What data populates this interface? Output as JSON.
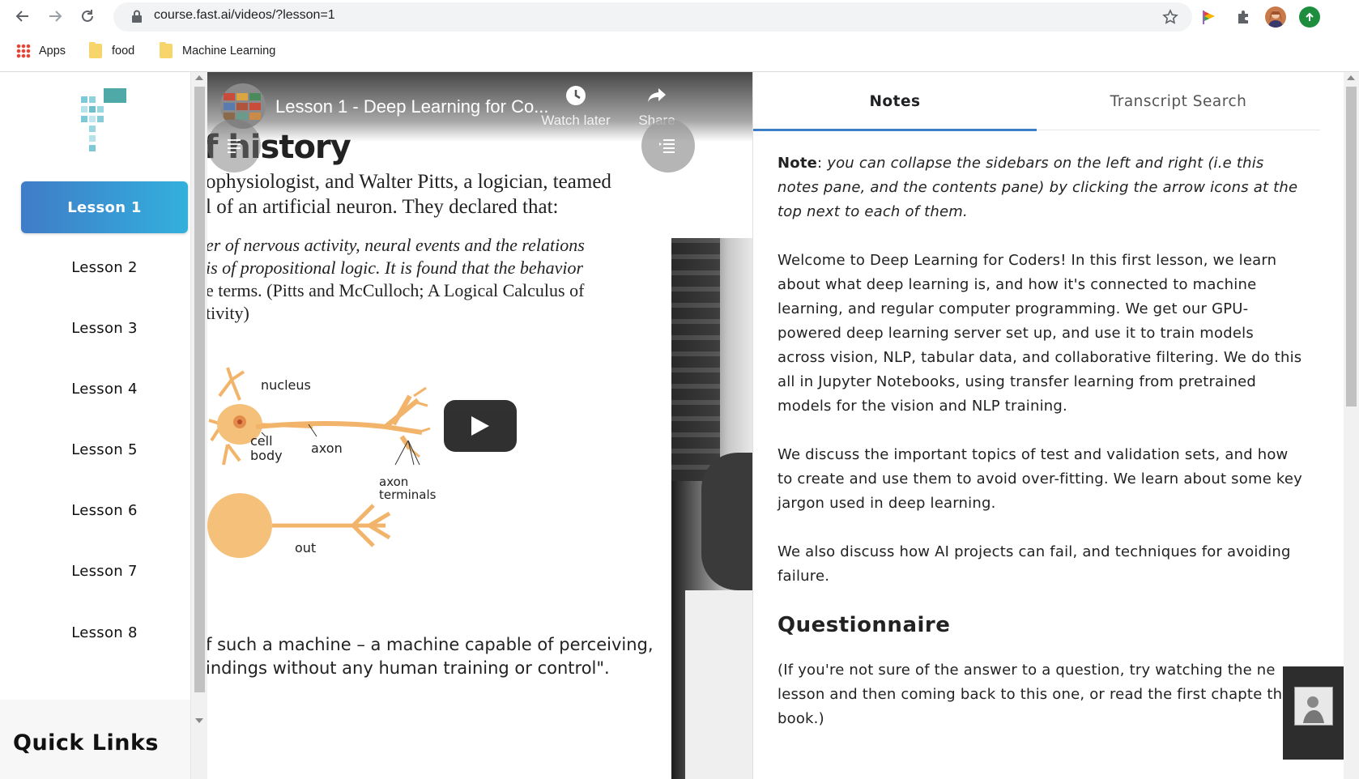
{
  "browser": {
    "url": "course.fast.ai/videos/?lesson=1",
    "bookmarks": [
      {
        "label": "Apps"
      },
      {
        "label": "food"
      },
      {
        "label": "Machine Learning"
      }
    ]
  },
  "sidebar": {
    "lessons": [
      {
        "label": "Lesson 1",
        "active": true
      },
      {
        "label": "Lesson 2"
      },
      {
        "label": "Lesson 3"
      },
      {
        "label": "Lesson 4"
      },
      {
        "label": "Lesson 5"
      },
      {
        "label": "Lesson 6"
      },
      {
        "label": "Lesson 7"
      },
      {
        "label": "Lesson 8"
      }
    ],
    "quick_links_title": "Quick Links"
  },
  "video": {
    "title": "Lesson 1 - Deep Learning for Co...",
    "watch_later_label": "Watch later",
    "share_label": "Share",
    "slide": {
      "heading": "f history",
      "lines": [
        "ophysiologist, and Walter Pitts, a logician, teamed",
        "l of an artificial neuron. They declared that:",
        "er of nervous activity, neural events and the relations",
        "is of propositional logic. It is found that the behavior",
        "e terms. (Pitts and McCulloch; A Logical Calculus of",
        "tivity)",
        "f such a machine – a machine capable of perceiving,",
        "indings without any human training or control\"."
      ],
      "diagram_labels": {
        "nucleus": "nucleus",
        "cell_body_1": "cell",
        "cell_body_2": "body",
        "axon": "axon",
        "axon_terminals_1": "axon",
        "axon_terminals_2": "terminals",
        "out": "out"
      }
    }
  },
  "notes_pane": {
    "tabs": [
      {
        "label": "Notes",
        "active": true
      },
      {
        "label": "Transcript Search"
      }
    ],
    "note_label": "Note",
    "note_text": "you can collapse the sidebars on the left and right (i.e this notes pane, and the contents pane) by clicking the arrow icons at the top next to each of them.",
    "paragraphs": [
      "Welcome to Deep Learning for Coders! In this first lesson, we learn about what deep learning is, and how it's connected to machine learning, and regular computer programming. We get our GPU-powered deep learning server set up, and use it to train models across vision, NLP, tabular data, and collaborative filtering. We do this all in Jupyter Notebooks, using transfer learning from pretrained models for the vision and NLP training.",
      "We discuss the important topics of test and validation sets, and how to create and use them to avoid over-fitting. We learn about some key jargon used in deep learning.",
      "We also discuss how AI projects can fail, and techniques for avoiding failure."
    ],
    "questionnaire_heading": "Questionnaire",
    "questionnaire_text": "(If you're not sure of the answer to a question, try watching the ne lesson and then coming back to this one, or read the first chapte the book.)"
  },
  "colors": {
    "accent_blue": "#3b7dc7",
    "active_lesson_start": "#3f7cc8",
    "active_lesson_end": "#33b0dc"
  }
}
